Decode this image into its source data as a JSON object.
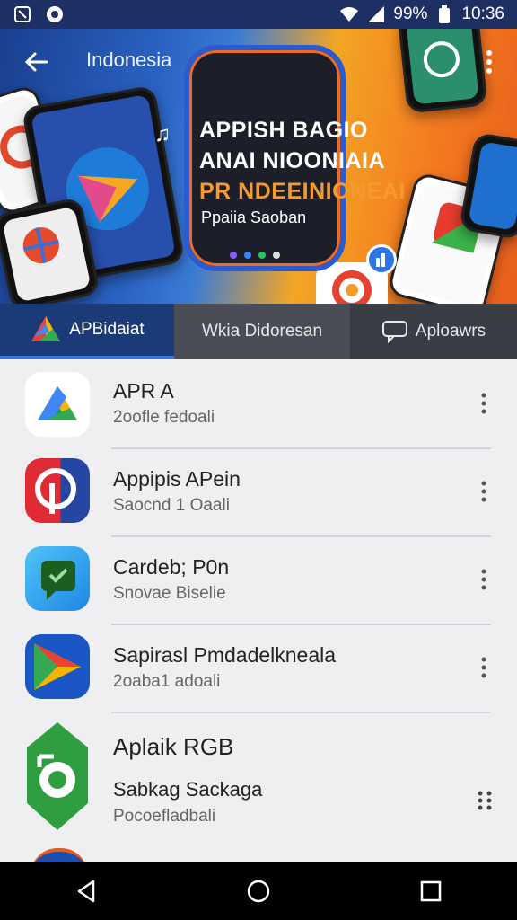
{
  "status_bar": {
    "battery": "99%",
    "time": "10:36",
    "icons": [
      "notification-icon",
      "app-icon",
      "wifi-icon",
      "signal-icon",
      "battery-icon"
    ]
  },
  "header": {
    "title": "Indonesia",
    "back_icon": "arrow-left-icon",
    "more_icon": "more-vertical-icon"
  },
  "promo": {
    "line1": "APPISH BAGIO",
    "line2": "ANAI NIOONIAIA",
    "line3": "PR NDEEINIONEAI",
    "subtitle": "Ppaiia Saoban"
  },
  "tabs": [
    {
      "label": "APBidaiat",
      "icon": "apps-logo-icon",
      "active": true
    },
    {
      "label": "Wkia Didoresan",
      "icon": "",
      "active": false
    },
    {
      "label": "Aploawrs",
      "icon": "chat-bubble-icon",
      "active": false
    }
  ],
  "apps": [
    {
      "name": "APR A",
      "subtitle": "2oofle fedoali",
      "icon": "drive-icon"
    },
    {
      "name": "Appipis APein",
      "subtitle": "Saocnd 1 Oaali",
      "icon": "pinterest-icon"
    },
    {
      "name": "Cardeb; P0n",
      "subtitle": "Snovae Biselie",
      "icon": "chat-icon"
    },
    {
      "name": "Sapirasl Pmdadelkneala",
      "subtitle": "2oaba1 adoali",
      "icon": "play-icon"
    },
    {
      "name": "Aplaik RGB",
      "subtitle2": "Sabkag Sackaga",
      "subtitle": "Pocoefladbali",
      "icon": "eye-shield-icon"
    }
  ],
  "colors": {
    "status_bar": "#1e2f63",
    "active_tab": "#1b3a78",
    "list_background": "#efeff1"
  }
}
